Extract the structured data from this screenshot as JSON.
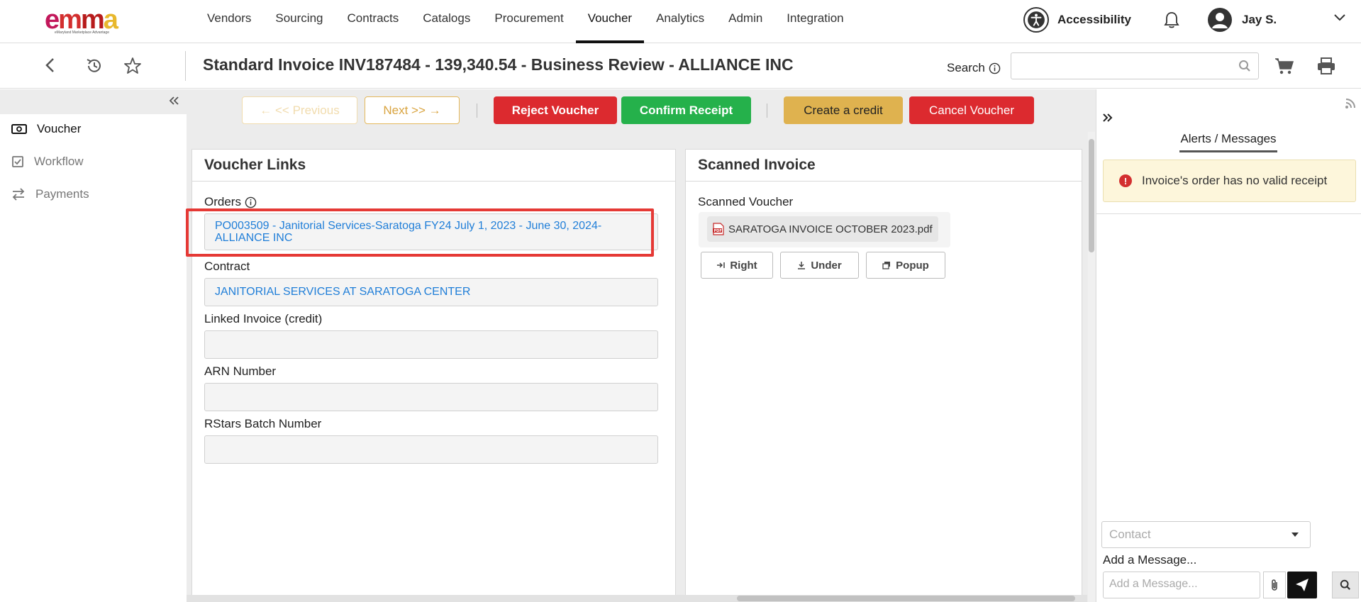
{
  "app": {
    "logo_text": "emma",
    "logo_tagline": "eMaryland Marketplace Advantage",
    "accent_color": "#dc2a2f",
    "success_color": "#25b14b",
    "warning_color": "#dfb24f",
    "link_color": "#1f7ed8"
  },
  "nav": {
    "items": [
      {
        "label": "Vendors"
      },
      {
        "label": "Sourcing"
      },
      {
        "label": "Contracts"
      },
      {
        "label": "Catalogs"
      },
      {
        "label": "Procurement"
      },
      {
        "label": "Voucher",
        "active": true
      },
      {
        "label": "Analytics"
      },
      {
        "label": "Admin"
      },
      {
        "label": "Integration"
      }
    ],
    "accessibility_label": "Accessibility",
    "user_name": "Jay S."
  },
  "header": {
    "title": "Standard Invoice INV187484 - 139,340.54 - Business Review - ALLIANCE INC",
    "search_label": "Search",
    "search_value": ""
  },
  "sidebar": {
    "items": [
      {
        "label": "Voucher",
        "icon": "money-icon",
        "active": true
      },
      {
        "label": "Workflow",
        "icon": "checkbox-icon"
      },
      {
        "label": "Payments",
        "icon": "exchange-icon"
      }
    ]
  },
  "toolbar": {
    "prev_label": "← << Previous",
    "next_label": "Next >> →",
    "reject_label": "Reject Voucher",
    "confirm_label": "Confirm Receipt",
    "credit_label": "Create a credit",
    "cancel_label": "Cancel Voucher"
  },
  "voucher_links": {
    "title": "Voucher Links",
    "orders_label": "Orders",
    "orders_line1": "PO003509 - Janitorial Services-Saratoga FY24 July 1, 2023 - June 30, 2024-",
    "orders_line2": "ALLIANCE INC",
    "contract_label": "Contract",
    "contract_value": "JANITORIAL SERVICES AT SARATOGA CENTER",
    "linked_invoice_label": "Linked Invoice (credit)",
    "linked_invoice_value": "",
    "arn_label": "ARN Number",
    "arn_value": "",
    "rstars_label": "RStars Batch Number",
    "rstars_value": ""
  },
  "scanned": {
    "title": "Scanned Invoice",
    "voucher_label": "Scanned Voucher",
    "file_name": "SARATOGA INVOICE OCTOBER 2023.pdf",
    "right_label": "Right",
    "under_label": "Under",
    "popup_label": "Popup"
  },
  "messages": {
    "tab_label": "Alerts / Messages",
    "alert_text": "Invoice's order has no valid receipt",
    "contact_placeholder": "Contact",
    "add_message_label": "Add a Message...",
    "message_placeholder": "Add a Message..."
  }
}
